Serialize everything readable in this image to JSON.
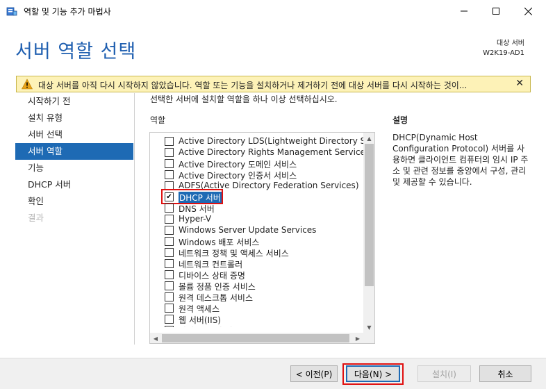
{
  "window": {
    "title": "역할 및 기능 추가 마법사",
    "app_icon": "server-manager-icon"
  },
  "header": {
    "page_title": "서버 역할 선택",
    "target_label": "대상 서버",
    "target_server": "W2K19-AD1"
  },
  "warning": {
    "icon": "warning-icon",
    "text": "대상 서버를 아직 다시 시작하지 않았습니다. 역할 또는 기능을 설치하거나 제거하기 전에 대상 서버를 다시 시작하는 것이...",
    "close": "✕"
  },
  "nav": {
    "items": [
      {
        "label": "시작하기 전",
        "state": "normal"
      },
      {
        "label": "설치 유형",
        "state": "normal"
      },
      {
        "label": "서버 선택",
        "state": "normal"
      },
      {
        "label": "서버 역할",
        "state": "active"
      },
      {
        "label": "기능",
        "state": "normal"
      },
      {
        "label": "DHCP 서버",
        "state": "normal"
      },
      {
        "label": "확인",
        "state": "normal"
      },
      {
        "label": "결과",
        "state": "disabled"
      }
    ]
  },
  "main": {
    "instruction": "선택한 서버에 설치할 역할을 하나 이상 선택하십시오.",
    "roles_label": "역할",
    "description_label": "설명",
    "description": "DHCP(Dynamic Host Configuration Protocol) 서버를 사용하면 클라이언트 컴퓨터의 임시 IP 주소 및 관련 정보를 중앙에서 구성, 관리 및 제공할 수 있습니다.",
    "roles": [
      {
        "label": "Active Directory LDS(Lightweight Directory Services)",
        "checked": false
      },
      {
        "label": "Active Directory Rights Management Services",
        "checked": false
      },
      {
        "label": "Active Directory 도메인 서비스",
        "checked": false
      },
      {
        "label": "Active Directory 인증서 서비스",
        "checked": false
      },
      {
        "label": "ADFS(Active Directory Federation Services)",
        "checked": false
      },
      {
        "label": "DHCP 서버",
        "checked": true
      },
      {
        "label": "DNS 서버",
        "checked": false
      },
      {
        "label": "Hyper-V",
        "checked": false
      },
      {
        "label": "Windows Server Update Services",
        "checked": false
      },
      {
        "label": "Windows 배포 서비스",
        "checked": false
      },
      {
        "label": "네트워크 정책 및 액세스 서비스",
        "checked": false
      },
      {
        "label": "네트워크 컨트롤러",
        "checked": false
      },
      {
        "label": "디바이스 상태 증명",
        "checked": false
      },
      {
        "label": "볼륨 정품 인증 서비스",
        "checked": false
      },
      {
        "label": "원격 데스크톱 서비스",
        "checked": false
      },
      {
        "label": "원격 액세스",
        "checked": false
      },
      {
        "label": "웹 서버(IIS)",
        "checked": false
      },
      {
        "label": "인쇄 및 문서 서비스",
        "checked": false
      }
    ]
  },
  "footer": {
    "prev": "< 이전(P)",
    "next": "다음(N) >",
    "install": "설치(I)",
    "cancel": "취소"
  }
}
